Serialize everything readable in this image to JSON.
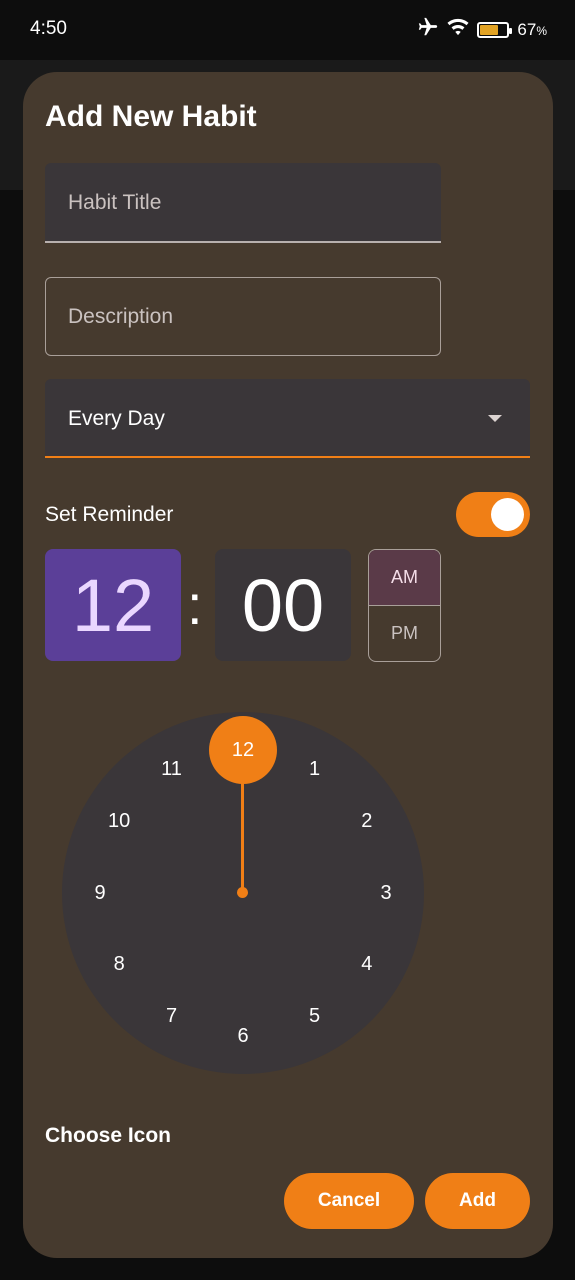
{
  "status_bar": {
    "time": "4:50",
    "battery_percent": "67",
    "battery_unit": "%",
    "battery_level": 0.67,
    "icons": [
      "airplane-icon",
      "wifi-icon",
      "battery-icon"
    ]
  },
  "dialog": {
    "title": "Add New Habit",
    "title_placeholder": "Habit Title",
    "description_placeholder": "Description",
    "frequency": "Every Day",
    "reminder_label": "Set Reminder",
    "reminder_on": true,
    "time": {
      "hour": "12",
      "separator": ":",
      "minute": "00",
      "am": "AM",
      "pm": "PM",
      "selected_period": "AM"
    },
    "clock": {
      "selected": "12",
      "numbers": [
        "1",
        "2",
        "3",
        "4",
        "5",
        "6",
        "7",
        "8",
        "9",
        "10",
        "11"
      ]
    },
    "choose_icon_label": "Choose Icon",
    "cancel_label": "Cancel",
    "add_label": "Add"
  },
  "colors": {
    "accent": "#f07f16",
    "dialog_bg": "#463a2e",
    "surface": "#3a3639",
    "hour_selected": "#5b3f98",
    "am_selected": "#5a3a48"
  }
}
